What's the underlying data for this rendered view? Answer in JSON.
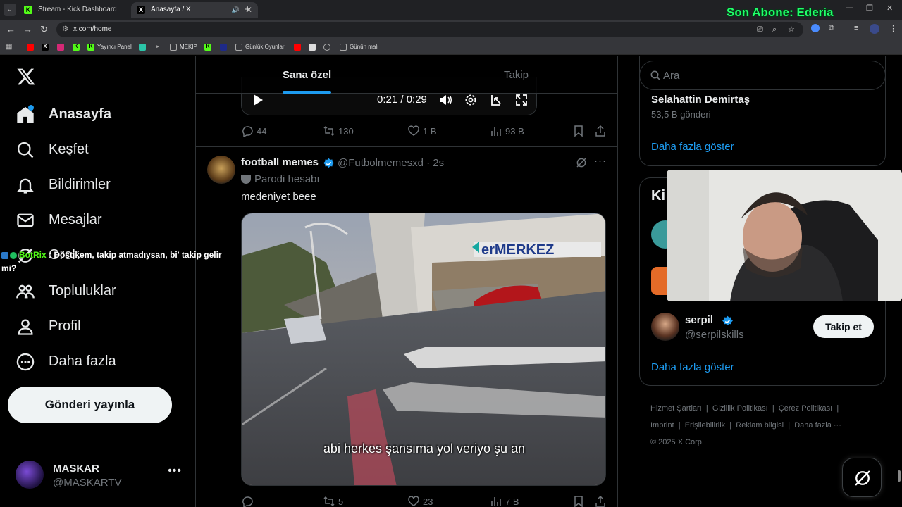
{
  "browser": {
    "tabs": [
      {
        "title": "Stream - Kick Dashboard",
        "icon": "kick-icon"
      },
      {
        "title": "Anasayfa / X",
        "icon": "x-icon"
      }
    ],
    "url": "x.com/home",
    "overlay_text": "Son Abone: Ederia",
    "bookmarks": [
      "Yayıncı Paneli",
      "MEKİP",
      "Günlük Oyunlar",
      "Günün malı"
    ]
  },
  "nav": {
    "items": [
      {
        "label": "Anasayfa",
        "icon": "home-icon"
      },
      {
        "label": "Keşfet",
        "icon": "search-icon"
      },
      {
        "label": "Bildirimler",
        "icon": "bell-icon"
      },
      {
        "label": "Mesajlar",
        "icon": "mail-icon"
      },
      {
        "label": "Grok",
        "icon": "grok-icon"
      },
      {
        "label": "Topluluklar",
        "icon": "communities-icon"
      },
      {
        "label": "Profil",
        "icon": "profile-icon"
      },
      {
        "label": "Daha fazla",
        "icon": "more-circle-icon"
      }
    ],
    "post_button": "Gönderi yayınla",
    "account": {
      "name": "MASKAR",
      "handle": "@MASKARTV"
    }
  },
  "chat_overlay": {
    "user": "BotRix",
    "message": ": Dostikem, takip atmadıysan, bi' takip gelir mi?"
  },
  "timeline": {
    "tabs": [
      "Sana özel",
      "Takip"
    ],
    "video_player": {
      "time": "0:21 / 0:29"
    },
    "prev_actions": {
      "replies": "44",
      "reposts": "130",
      "likes": "1 B",
      "views": "93 B"
    },
    "tweet": {
      "name": "football memes",
      "handle": "@Futbolmemesxd",
      "time": "· 2s",
      "label": "Parodi hesabı",
      "text": "medeniyet beee",
      "media_subtitle": "abi herkes şansıma yol veriyo şu an",
      "media_sign": "erMERKEZ",
      "actions": {
        "replies": "",
        "reposts": "5",
        "likes": "23",
        "views": "7 B"
      }
    }
  },
  "sidebar": {
    "search_placeholder": "Ara",
    "trend": {
      "name": "Selahattin Demirtaş",
      "count": "53,5 B gönderi"
    },
    "show_more": "Daha fazla göster",
    "who_to_follow_title": "Ki",
    "suggestion": {
      "name": "serpil",
      "handle": "@serpilskills",
      "button": "Takip et"
    },
    "show_more_2": "Daha fazla göster",
    "footer": [
      "Hizmet Şartları",
      "Gizlilik Politikası",
      "Çerez Politikası",
      "Imprint",
      "Erişilebilirlik",
      "Reklam bilgisi",
      "Daha fazla ···",
      "© 2025 X Corp."
    ]
  },
  "colors": {
    "accent": "#1d9bf0",
    "kick": "#53fc18",
    "overlay": "#21ff6a"
  }
}
